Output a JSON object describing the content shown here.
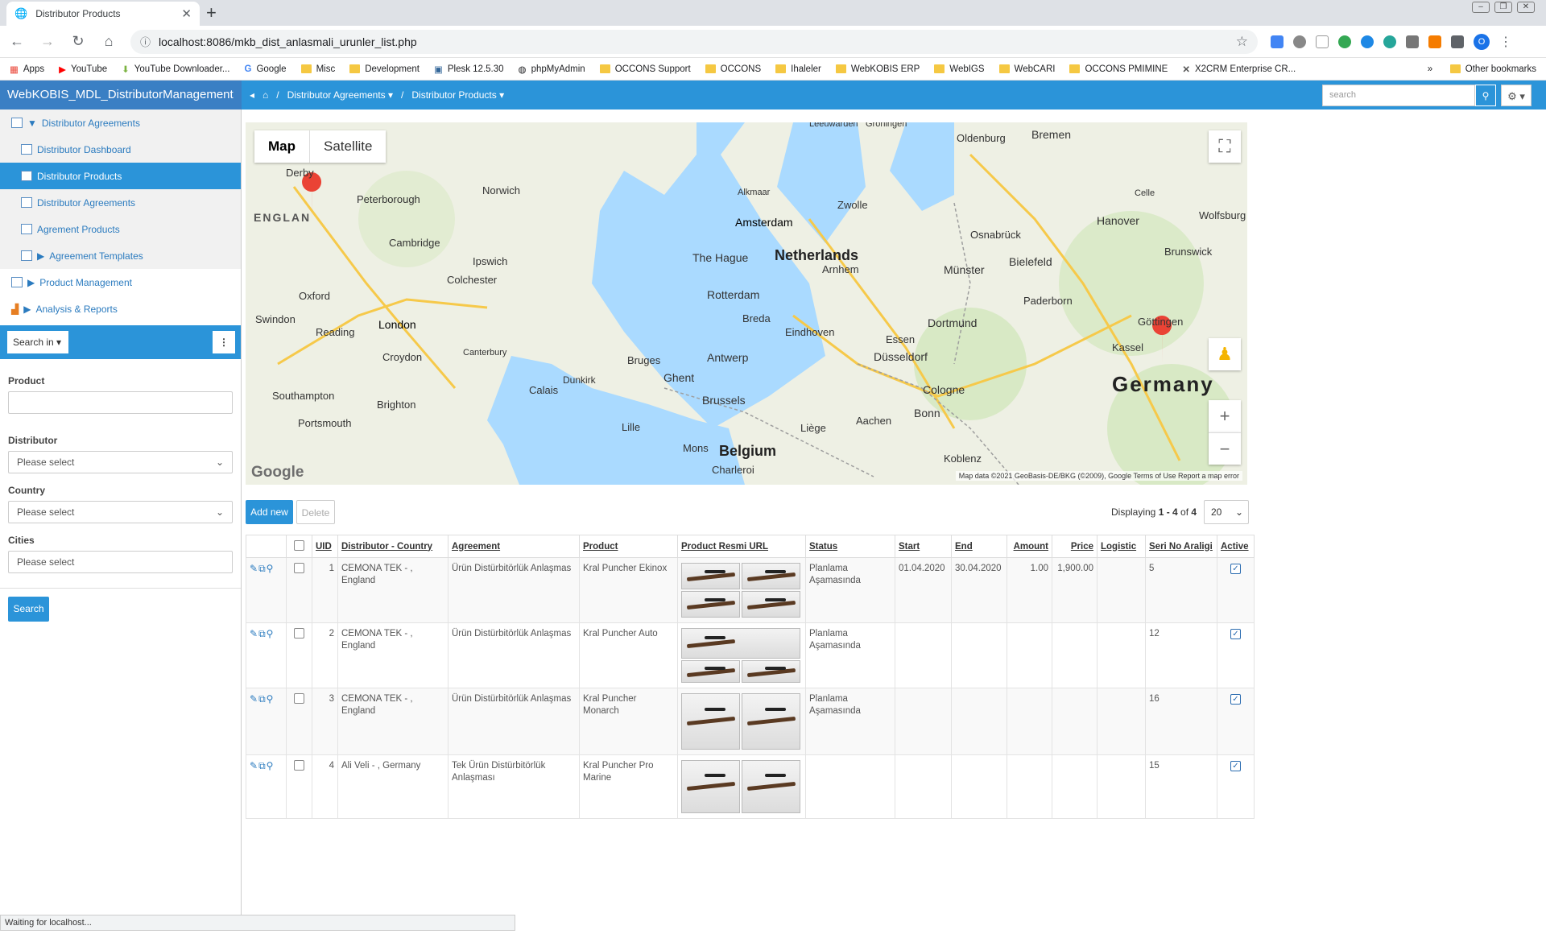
{
  "browser": {
    "tab_title": "Distributor Products",
    "url": "localhost:8086/mkb_dist_anlasmali_urunler_list.php",
    "profile_initial": "O",
    "bookmarks": [
      "Apps",
      "YouTube",
      "YouTube Downloader...",
      "Google",
      "Misc",
      "Development",
      "Plesk 12.5.30",
      "phpMyAdmin",
      "OCCONS Support",
      "OCCONS",
      "Ihaleler",
      "WebKOBIS ERP",
      "WebIGS",
      "WebCARI",
      "OCCONS PMIMINE",
      "X2CRM Enterprise CR..."
    ],
    "other_bookmarks": "Other bookmarks",
    "status": "Waiting for localhost..."
  },
  "app": {
    "name": "WebKOBIS_MDL_DistributorManagement",
    "breadcrumb": [
      "Distributor Agreements",
      "Distributor Products"
    ],
    "search_placeholder": "search"
  },
  "sidebar": {
    "items": [
      {
        "label": "Distributor Agreements",
        "level": 0
      },
      {
        "label": "Distributor Dashboard",
        "level": 1
      },
      {
        "label": "Distributor Products",
        "level": 1,
        "selected": true
      },
      {
        "label": "Distributor Agreements",
        "level": 1
      },
      {
        "label": "Agrement Products",
        "level": 1
      },
      {
        "label": "Agreement Templates",
        "level": 1
      },
      {
        "label": "Product Management",
        "level": 0
      },
      {
        "label": "Analysis & Reports",
        "level": 0
      }
    ],
    "search_in": "Search in",
    "filters": {
      "product_label": "Product",
      "distributor_label": "Distributor",
      "distributor_value": "Please select",
      "country_label": "Country",
      "country_value": "Please select",
      "cities_label": "Cities",
      "cities_value": "Please select"
    },
    "search_button": "Search"
  },
  "map": {
    "type_map": "Map",
    "type_satellite": "Satellite",
    "footer": "Map data ©2021 GeoBasis-DE/BKG (©2009), Google   Terms of Use   Report a map error",
    "logo": "Google",
    "countries": [
      "Netherlands",
      "Germany",
      "Belgium",
      "ENGLAN"
    ],
    "cities": [
      "Derby",
      "Peterborough",
      "Norwich",
      "Cambridge",
      "Ipswich",
      "Colchester",
      "Oxford",
      "London",
      "Swindon",
      "Reading",
      "Croydon",
      "Canterbury",
      "Southampton",
      "Brighton",
      "Portsmouth",
      "Calais",
      "Dunkirk",
      "Bruges",
      "Ghent",
      "Brussels",
      "Lille",
      "Mons",
      "Charleroi",
      "Antwerp",
      "Breda",
      "Eindhoven",
      "Rotterdam",
      "The Hague",
      "Amsterdam",
      "Alkmaar",
      "Zwolle",
      "Arnhem",
      "Oldenburg",
      "Bremen",
      "Celle",
      "Wolfsburg",
      "Hanover",
      "Osnabrück",
      "Bielefeld",
      "Münster",
      "Paderborn",
      "Dortmund",
      "Essen",
      "Düsseldorf",
      "Cologne",
      "Bonn",
      "Aachen",
      "Liège",
      "Kassel",
      "Göttingen",
      "Brunswick",
      "Koblenz",
      "Leeuwarden",
      "Groningen"
    ]
  },
  "table": {
    "add_new": "Add new",
    "delete": "Delete",
    "displaying_prefix": "Displaying ",
    "displaying_range": "1 - 4",
    "displaying_mid": " of ",
    "displaying_total": "4",
    "page_size": "20",
    "columns": [
      "UID",
      "Distributor - Country",
      "Agreement",
      "Product",
      "Product Resmi URL",
      "Status",
      "Start",
      "End",
      "Amount",
      "Price",
      "Logistic",
      "Seri No Araligi",
      "Active"
    ],
    "rows": [
      {
        "uid": "1",
        "distributor": "CEMONA TEK - , England",
        "agreement": "Ürün Distürbitörlük Anlaşmas",
        "product": "Kral Puncher Ekinox",
        "status": "Planlama Aşamasında",
        "start": "01.04.2020",
        "end": "30.04.2020",
        "amount": "1.00",
        "price": "1,900.00",
        "logistic": "",
        "seri": "5",
        "active": true
      },
      {
        "uid": "2",
        "distributor": "CEMONA TEK - , England",
        "agreement": "Ürün Distürbitörlük Anlaşmas",
        "product": "Kral Puncher Auto",
        "status": "Planlama Aşamasında",
        "start": "",
        "end": "",
        "amount": "",
        "price": "",
        "logistic": "",
        "seri": "12",
        "active": true
      },
      {
        "uid": "3",
        "distributor": "CEMONA TEK - , England",
        "agreement": "Ürün Distürbitörlük Anlaşmas",
        "product": "Kral Puncher Monarch",
        "status": "Planlama Aşamasında",
        "start": "",
        "end": "",
        "amount": "",
        "price": "",
        "logistic": "",
        "seri": "16",
        "active": true
      },
      {
        "uid": "4",
        "distributor": "Ali Veli - , Germany",
        "agreement": "Tek Ürün Distürbitörlük Anlaşması",
        "product": "Kral Puncher Pro Marine",
        "status": "",
        "start": "",
        "end": "",
        "amount": "",
        "price": "",
        "logistic": "",
        "seri": "15",
        "active": true
      }
    ]
  }
}
